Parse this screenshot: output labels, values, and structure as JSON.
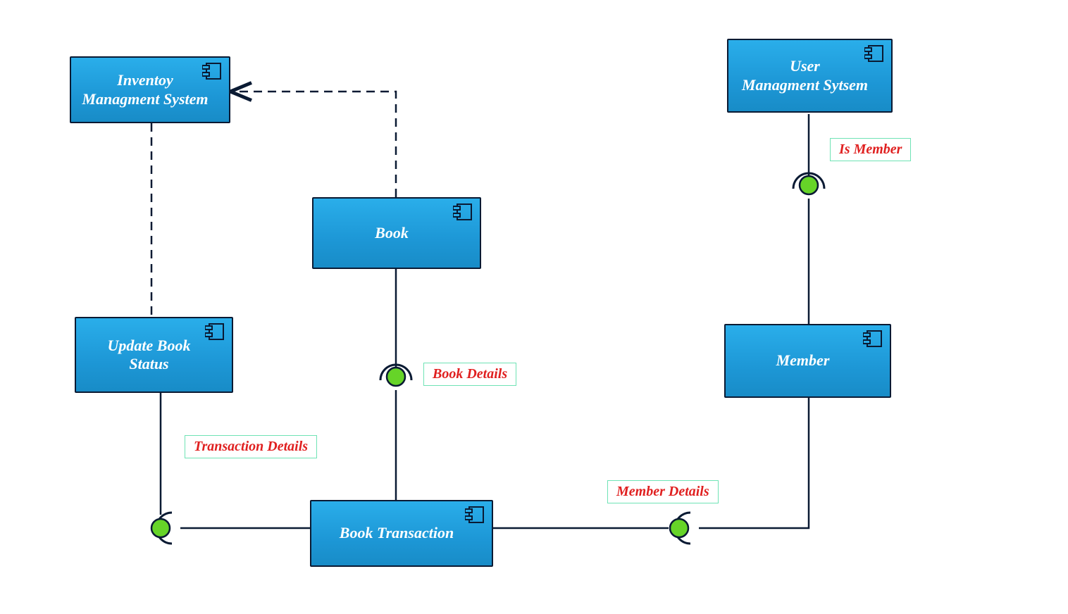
{
  "components": {
    "inventory_mgmt": {
      "label": "Inventoy\nManagment System"
    },
    "user_mgmt": {
      "label": "User\nManagment Sytsem"
    },
    "book": {
      "label": "Book"
    },
    "update_book": {
      "label": "Update Book\nStatus"
    },
    "member": {
      "label": "Member"
    },
    "book_txn": {
      "label": "Book Transaction"
    }
  },
  "interfaces": {
    "is_member": {
      "label": "Is Member"
    },
    "book_details": {
      "label": "Book Details"
    },
    "txn_details": {
      "label": "Transaction Details"
    },
    "member_details": {
      "label": "Member Details"
    }
  },
  "colors": {
    "component_fill_top": "#2aaeea",
    "component_fill_bottom": "#188cc7",
    "component_border": "#0a1a33",
    "label_border": "#6fe3b5",
    "label_text": "#e02020",
    "ball_fill": "#66d428",
    "wire": "#0a1a33"
  }
}
